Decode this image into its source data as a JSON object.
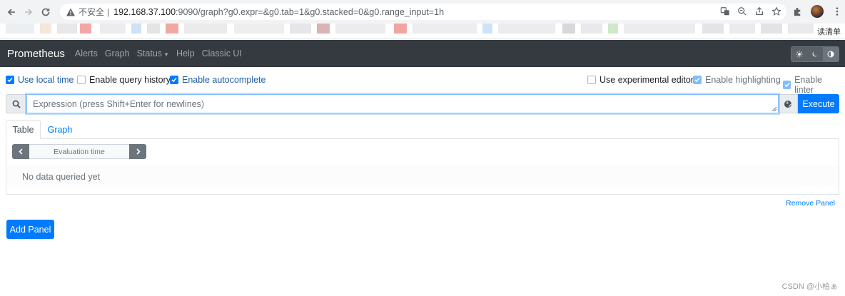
{
  "browser": {
    "insecure_label": "不安全",
    "separator": "|",
    "url_host": "192.168.37.100",
    "url_rest": ":9090/graph?g0.expr=&g0.tab=1&g0.stacked=0&g0.range_input=1h",
    "bookmark_tail": "读清单"
  },
  "navbar": {
    "brand": "Prometheus",
    "links": [
      "Alerts",
      "Graph",
      "Status",
      "Help",
      "Classic UI"
    ]
  },
  "options": {
    "local_time": "Use local time",
    "query_history": "Enable query history",
    "autocomplete": "Enable autocomplete",
    "experimental_editor": "Use experimental editor",
    "highlighting": "Enable highlighting",
    "linter": "Enable linter"
  },
  "expression": {
    "placeholder": "Expression (press Shift+Enter for newlines)",
    "execute_label": "Execute"
  },
  "panel": {
    "tabs": [
      "Table",
      "Graph"
    ],
    "evaluation_time_placeholder": "Evaluation time",
    "empty_message": "No data queried yet",
    "remove_label": "Remove Panel"
  },
  "add_panel_label": "Add Panel",
  "watermark": "CSDN @小柏ぁ",
  "colors": {
    "primary": "#007bff",
    "navbar": "#343a40",
    "secondary": "#6c757d"
  }
}
